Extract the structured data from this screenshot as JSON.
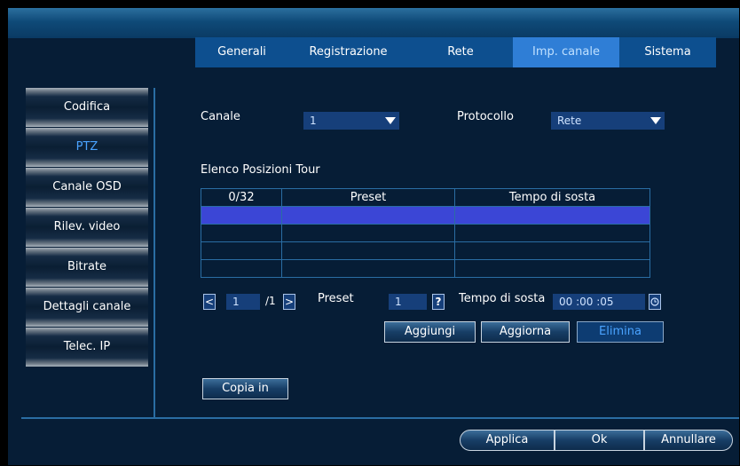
{
  "tabs": [
    {
      "label": "Generali"
    },
    {
      "label": "Registrazione"
    },
    {
      "label": "Rete"
    },
    {
      "label": "Imp. canale",
      "active": true
    },
    {
      "label": "Sistema"
    }
  ],
  "sidebar": {
    "items": [
      {
        "label": "Codifica"
      },
      {
        "label": "PTZ",
        "active": true
      },
      {
        "label": "Canale OSD"
      },
      {
        "label": "Rilev. video"
      },
      {
        "label": "Bitrate"
      },
      {
        "label": "Dettagli canale"
      },
      {
        "label": "Telec. IP"
      }
    ]
  },
  "form": {
    "channel_label": "Canale",
    "channel_value": "1",
    "protocol_label": "Protocollo",
    "protocol_value": "Rete",
    "tour_list_label": "Elenco Posizioni Tour"
  },
  "table": {
    "headers": [
      "0/32",
      "Preset",
      "Tempo di sosta"
    ],
    "rows": [
      [
        "",
        "",
        ""
      ],
      [
        "",
        "",
        ""
      ],
      [
        "",
        "",
        ""
      ],
      [
        "",
        "",
        ""
      ]
    ]
  },
  "pager": {
    "current": "1",
    "total": "/1",
    "prev_icon": "chevron-left-icon",
    "next_icon": "chevron-right-icon"
  },
  "preset": {
    "label": "Preset",
    "value": "1",
    "help": "?"
  },
  "dwell": {
    "label": "Tempo di sosta",
    "value": "00 :00 :05",
    "icon": "clock-icon"
  },
  "actions": {
    "add": "Aggiungi",
    "update": "Aggiorna",
    "delete": "Elimina",
    "copy": "Copia in"
  },
  "footer": {
    "apply": "Applica",
    "ok": "Ok",
    "cancel": "Annullare"
  },
  "colors": {
    "background": "#061d36",
    "tab": "#0d4f8f",
    "tab_active": "#2f7ed6",
    "selected_row": "#3b46d6",
    "accent_text": "#4aa3ff"
  }
}
